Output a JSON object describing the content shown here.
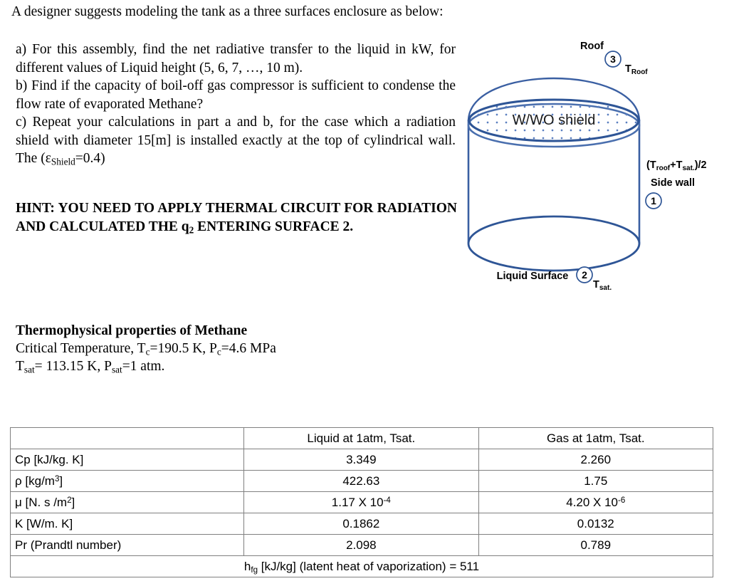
{
  "intro": {
    "text": "A designer suggests modeling the tank as a three surfaces enclosure as below:"
  },
  "questions": {
    "a": "a) For this assembly, find the net radiative transfer to the liquid in kW, for different values of Liquid height (5, 6, 7, …, 10 m).",
    "b": "b) Find if the capacity of boil-off gas compressor is sufficient to condense the flow rate of evaporated Methane?",
    "c_part1": "c) Repeat your calculations in part a and b, for the case which a radiation shield with diameter 15[m] is installed exactly at the top of cylindrical wall. The (",
    "c_epsilon": "ε",
    "c_epsilon_sub": "Shield",
    "c_part2": "=0.4)"
  },
  "hint": {
    "text_before_q": "HINT: YOU NEED TO APPLY THERMAL CIRCUIT FOR RADIATION AND CALCULATED THE ",
    "q_symbol": "q",
    "q_sub": "2",
    "text_after_q": " ENTERING SURFACE 2."
  },
  "properties": {
    "title": "Thermophysical properties of Methane",
    "line1_pre": "Critical Temperature, T",
    "line1_sub1": "c",
    "line1_mid": "=190.5 K, P",
    "line1_sub2": "c",
    "line1_post": "=4.6 MPa",
    "line2_pre": "T",
    "line2_sub1": "sat",
    "line2_mid": "= 113.15 K, P",
    "line2_sub2": "sat",
    "line2_post": "=1 atm."
  },
  "diagram": {
    "stroke_color": "#3A5FA2",
    "label_roof": "Roof",
    "label_roof_number": "3",
    "label_t_roof_main": "T",
    "label_t_roof_sub": "Roof",
    "label_shield": "W/WO shield",
    "label_sidewall_temp_open": "(T",
    "label_sidewall_temp_sub1": "roof",
    "label_sidewall_temp_plus": "+T",
    "label_sidewall_temp_sub2": "sat.",
    "label_sidewall_temp_close": ")/2",
    "label_sidewall": "Side wall",
    "label_sidewall_number": "1",
    "label_liquid_surface": "Liquid Surface",
    "label_liquid_number": "2",
    "label_tsat_main": "T",
    "label_tsat_sub": "sat."
  },
  "table": {
    "headers": [
      "",
      "Liquid at 1atm, Tsat.",
      "Gas at 1atm, Tsat."
    ],
    "rows": [
      {
        "label_pre": "Cp [kJ/kg. K]",
        "label_sup": "",
        "label_post": "",
        "liquid_main": "3.349",
        "liquid_sup": "",
        "gas_main": "2.260",
        "gas_sup": ""
      },
      {
        "label_pre": "ρ [kg/m",
        "label_sup": "3",
        "label_post": "]",
        "liquid_main": "422.63",
        "liquid_sup": "",
        "gas_main": "1.75",
        "gas_sup": ""
      },
      {
        "label_pre": "μ [N. s /m",
        "label_sup": "2",
        "label_post": "]",
        "liquid_main": "1.17 X 10",
        "liquid_sup": "-4",
        "gas_main": "4.20 X 10",
        "gas_sup": "-6"
      },
      {
        "label_pre": "K [W/m. K]",
        "label_sup": "",
        "label_post": "",
        "liquid_main": "0.1862",
        "liquid_sup": "",
        "gas_main": "0.0132",
        "gas_sup": ""
      },
      {
        "label_pre": "Pr (Prandtl number)",
        "label_sup": "",
        "label_post": "",
        "liquid_main": "2.098",
        "liquid_sup": "",
        "gas_main": "0.789",
        "gas_sup": ""
      }
    ],
    "footer_pre": "h",
    "footer_sub": "fg",
    "footer_post": " [kJ/kg] (latent heat of vaporization) = 511"
  }
}
